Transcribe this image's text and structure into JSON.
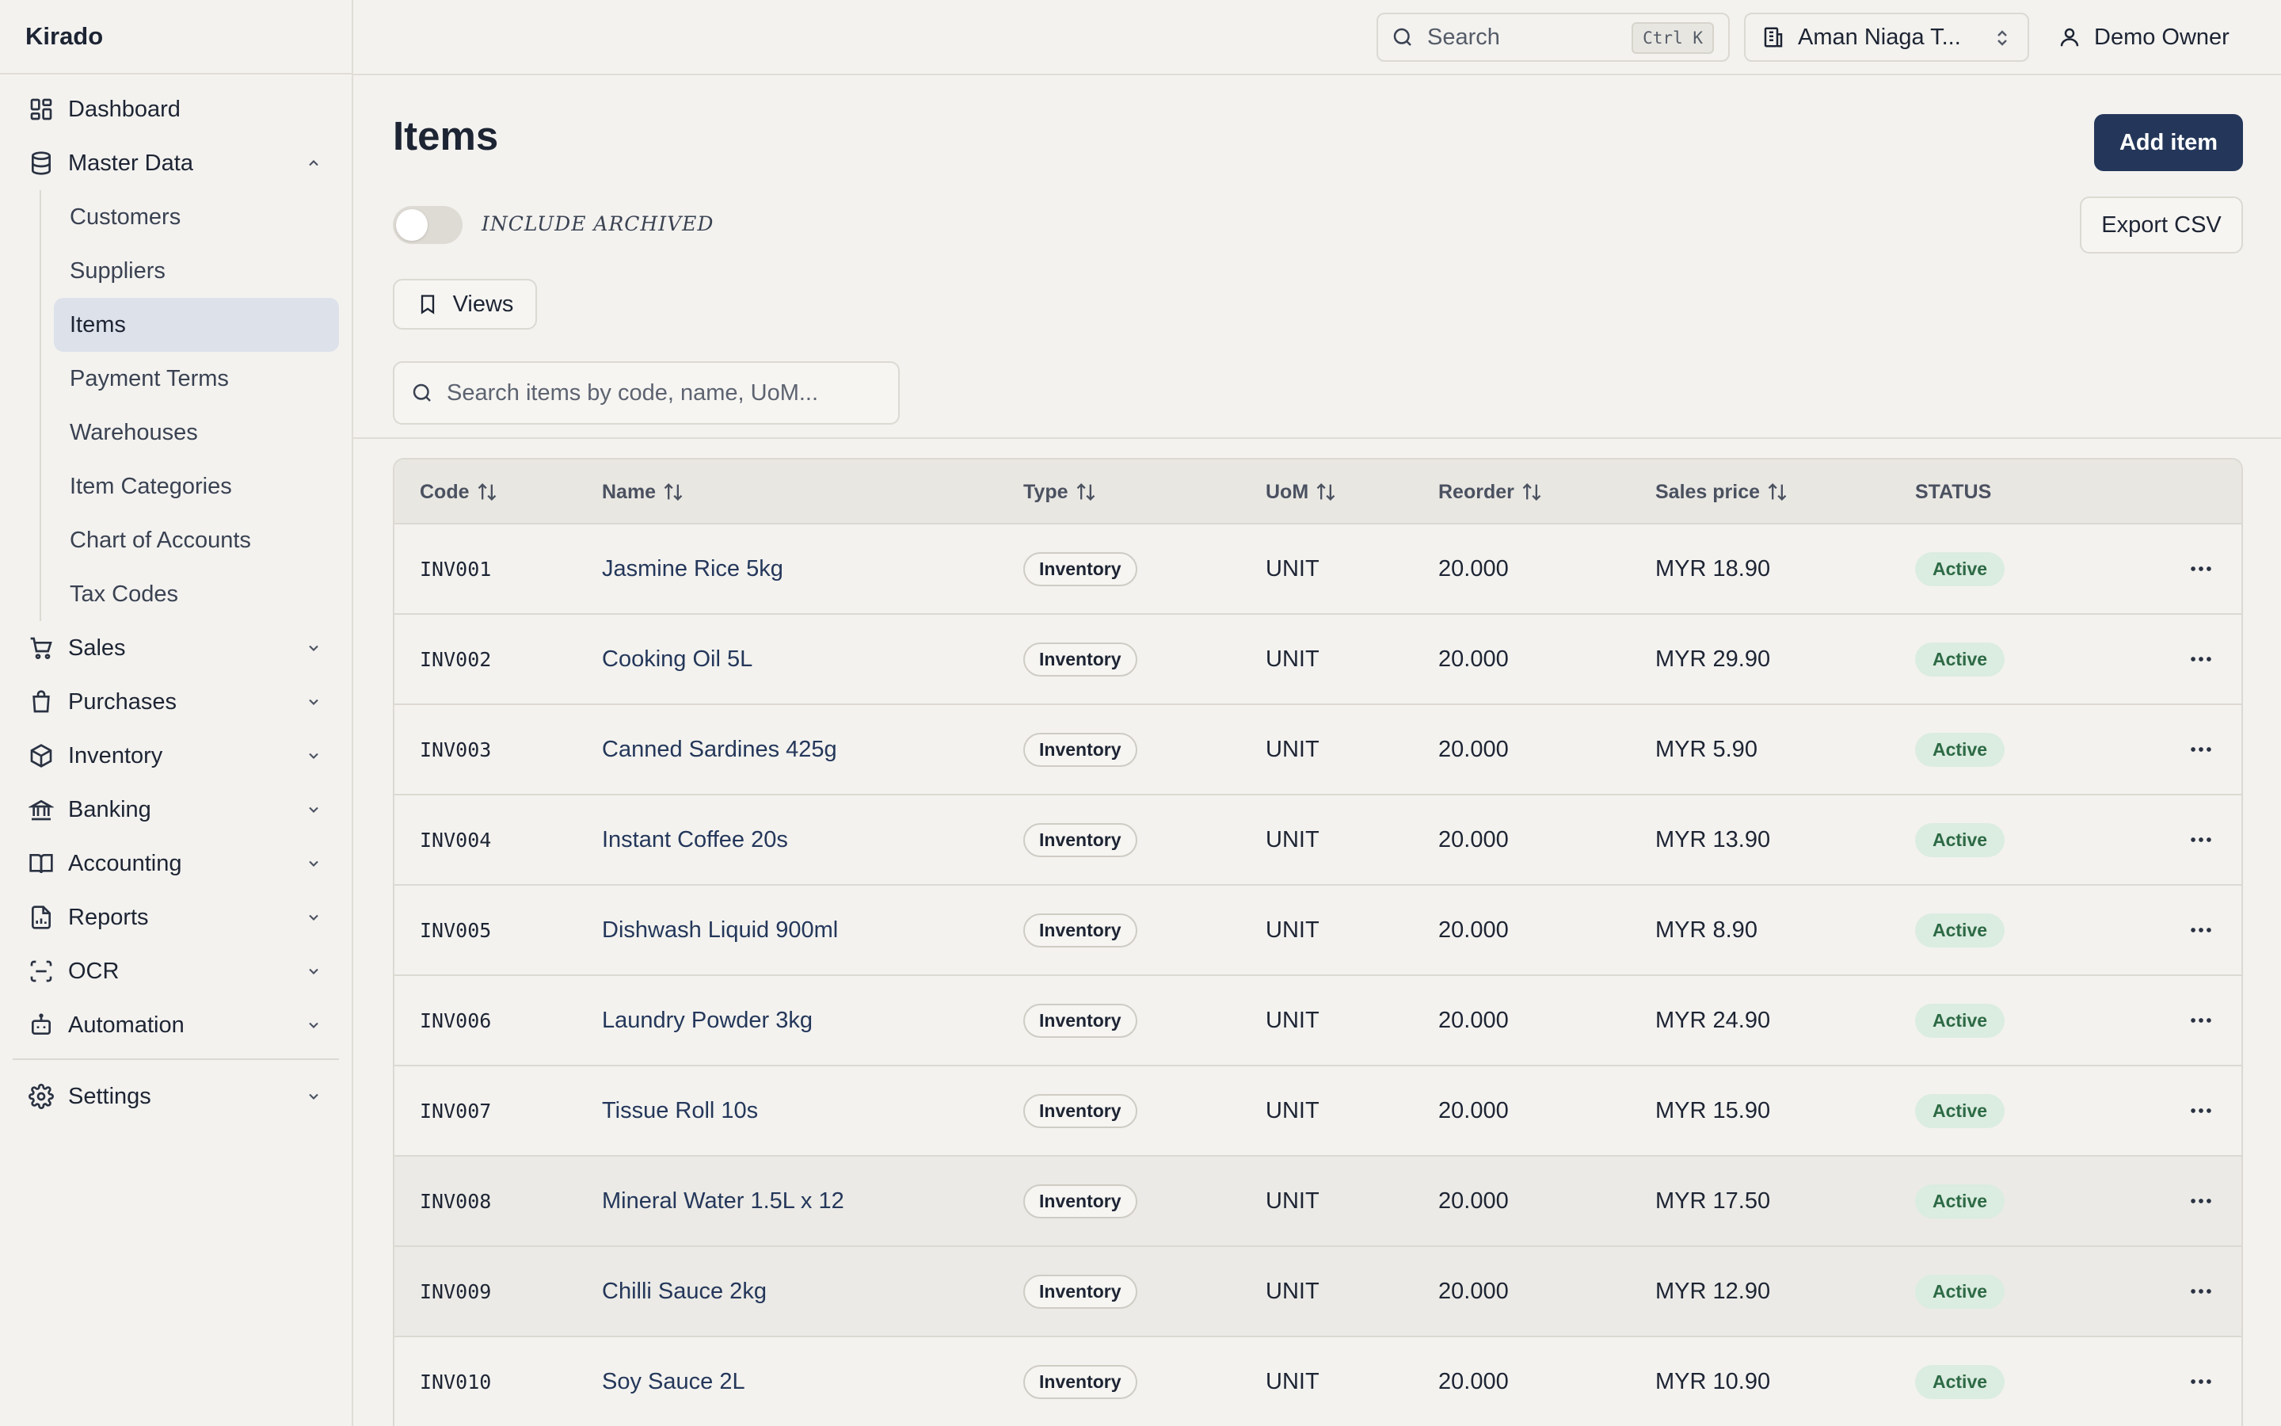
{
  "app": {
    "brand": "Kirado"
  },
  "sidebar": {
    "top": [
      {
        "label": "Dashboard",
        "icon": "dashboard-icon"
      },
      {
        "label": "Master Data",
        "icon": "database-icon"
      }
    ],
    "master_sub": [
      "Customers",
      "Suppliers",
      "Items",
      "Payment Terms",
      "Warehouses",
      "Item Categories",
      "Chart of Accounts",
      "Tax Codes"
    ],
    "groups": [
      {
        "label": "Sales",
        "icon": "cart-icon"
      },
      {
        "label": "Purchases",
        "icon": "shopping-bag-icon"
      },
      {
        "label": "Inventory",
        "icon": "package-icon"
      },
      {
        "label": "Banking",
        "icon": "bank-icon"
      },
      {
        "label": "Accounting",
        "icon": "book-icon"
      },
      {
        "label": "Reports",
        "icon": "report-icon"
      },
      {
        "label": "OCR",
        "icon": "scan-icon"
      },
      {
        "label": "Automation",
        "icon": "bot-icon"
      }
    ],
    "settings": "Settings"
  },
  "topbar": {
    "search_label": "Search",
    "search_kbd": "Ctrl K",
    "org": "Aman Niaga T...",
    "user": "Demo Owner"
  },
  "main": {
    "title": "Items",
    "add_label": "Add item",
    "export_label": "Export CSV",
    "archived_label": "INCLUDE ARCHIVED",
    "views_label": "Views",
    "search_placeholder": "Search items by code, name, UoM..."
  },
  "table": {
    "headers": {
      "code": "Code",
      "name": "Name",
      "type": "Type",
      "uom": "UoM",
      "reorder": "Reorder",
      "price": "Sales price",
      "status": "STATUS"
    },
    "rows": [
      {
        "code": "INV001",
        "name": "Jasmine Rice 5kg",
        "type": "Inventory",
        "uom": "UNIT",
        "reorder": "20.000",
        "price": "MYR 18.90",
        "status": "Active"
      },
      {
        "code": "INV002",
        "name": "Cooking Oil 5L",
        "type": "Inventory",
        "uom": "UNIT",
        "reorder": "20.000",
        "price": "MYR 29.90",
        "status": "Active"
      },
      {
        "code": "INV003",
        "name": "Canned Sardines 425g",
        "type": "Inventory",
        "uom": "UNIT",
        "reorder": "20.000",
        "price": "MYR 5.90",
        "status": "Active"
      },
      {
        "code": "INV004",
        "name": "Instant Coffee 20s",
        "type": "Inventory",
        "uom": "UNIT",
        "reorder": "20.000",
        "price": "MYR 13.90",
        "status": "Active"
      },
      {
        "code": "INV005",
        "name": "Dishwash Liquid 900ml",
        "type": "Inventory",
        "uom": "UNIT",
        "reorder": "20.000",
        "price": "MYR 8.90",
        "status": "Active"
      },
      {
        "code": "INV006",
        "name": "Laundry Powder 3kg",
        "type": "Inventory",
        "uom": "UNIT",
        "reorder": "20.000",
        "price": "MYR 24.90",
        "status": "Active"
      },
      {
        "code": "INV007",
        "name": "Tissue Roll 10s",
        "type": "Inventory",
        "uom": "UNIT",
        "reorder": "20.000",
        "price": "MYR 15.90",
        "status": "Active"
      },
      {
        "code": "INV008",
        "name": "Mineral Water 1.5L x 12",
        "type": "Inventory",
        "uom": "UNIT",
        "reorder": "20.000",
        "price": "MYR 17.50",
        "status": "Active"
      },
      {
        "code": "INV009",
        "name": "Chilli Sauce 2kg",
        "type": "Inventory",
        "uom": "UNIT",
        "reorder": "20.000",
        "price": "MYR 12.90",
        "status": "Active"
      },
      {
        "code": "INV010",
        "name": "Soy Sauce 2L",
        "type": "Inventory",
        "uom": "UNIT",
        "reorder": "20.000",
        "price": "MYR 10.90",
        "status": "Active"
      }
    ]
  },
  "colors": {
    "primary": "#24375a",
    "active_bg": "#dbece0",
    "active_text": "#2d6a45",
    "nav_active": "#dce1ea"
  }
}
